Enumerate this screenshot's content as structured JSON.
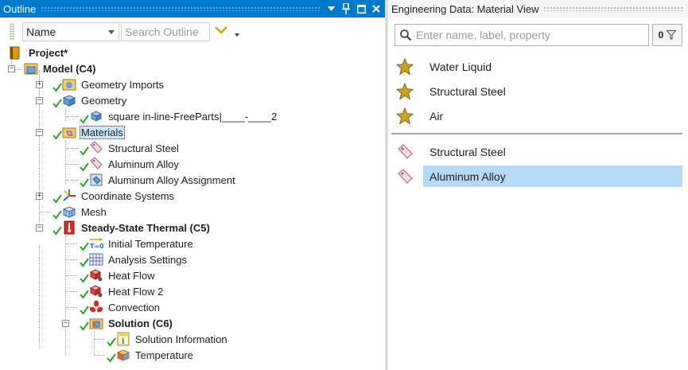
{
  "outline": {
    "title": "Outline",
    "toolbar": {
      "name_select": "Name",
      "search_placeholder": "Search Outline"
    },
    "tree": {
      "project": "Project*",
      "model": "Model (C4)",
      "geometry_imports": "Geometry Imports",
      "geometry": "Geometry",
      "part": "square  in-line-FreeParts|____-____2",
      "materials": "Materials",
      "mat_structural_steel": "Structural Steel",
      "mat_aluminum_alloy": "Aluminum Alloy",
      "mat_assignment": "Aluminum Alloy Assignment",
      "coordinate_systems": "Coordinate Systems",
      "mesh": "Mesh",
      "steady_state": "Steady-State Thermal (C5)",
      "initial_temp": "Initial Temperature",
      "analysis_settings": "Analysis Settings",
      "heat_flow": "Heat Flow",
      "heat_flow_2": "Heat Flow 2",
      "convection": "Convection",
      "solution": "Solution (C6)",
      "solution_info": "Solution Information",
      "temperature": "Temperature"
    },
    "icon_text": {
      "init_temp": "T=0",
      "sol_info": "i"
    }
  },
  "material_view": {
    "title": "Engineering Data: Material View",
    "search_placeholder": "Enter name, label, property",
    "filter_count": "0",
    "favorites": [
      "Water Liquid",
      "Structural Steel",
      "Air"
    ],
    "in_model": [
      "Structural Steel",
      "Aluminum Alloy"
    ],
    "selected_item": "Aluminum Alloy"
  },
  "colors": {
    "accent": "#007acc",
    "selection": "#b5d9f7",
    "check": "#2ea02e",
    "star": "#c9a227"
  }
}
